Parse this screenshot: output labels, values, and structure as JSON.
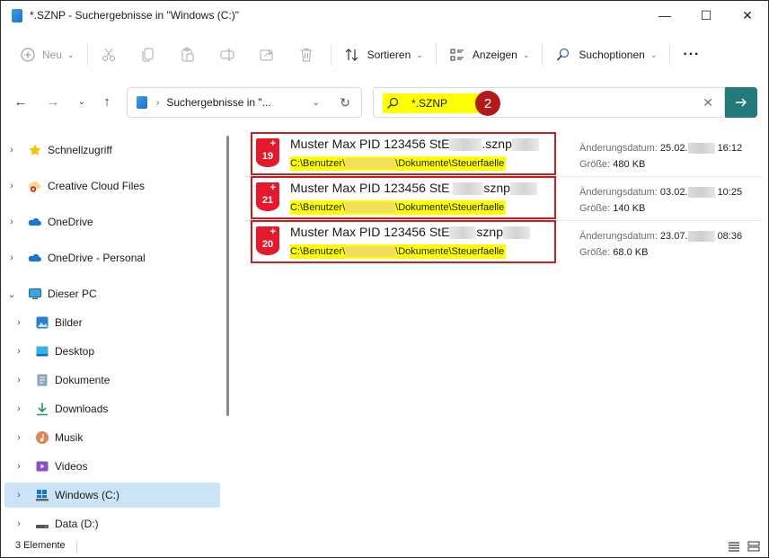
{
  "window": {
    "title": "*.SZNP - Suchergebnisse in \"Windows (C:)\""
  },
  "toolbar": {
    "new_label": "Neu",
    "sort_label": "Sortieren",
    "view_label": "Anzeigen",
    "search_options_label": "Suchoptionen",
    "more_label": "···"
  },
  "address": {
    "path": "Suchergebnisse in \"..."
  },
  "search": {
    "query": "*.SZNP",
    "badge": "2"
  },
  "sidebar": {
    "items": [
      {
        "label": "Schnellzugriff",
        "icon": "star-icon"
      },
      {
        "label": "Creative Cloud Files",
        "icon": "creative-cloud-icon"
      },
      {
        "label": "OneDrive",
        "icon": "cloud-icon"
      },
      {
        "label": "OneDrive - Personal",
        "icon": "cloud-icon"
      },
      {
        "label": "Dieser PC",
        "icon": "monitor-icon"
      },
      {
        "label": "Bilder",
        "icon": "pictures-icon"
      },
      {
        "label": "Desktop",
        "icon": "desktop-icon"
      },
      {
        "label": "Dokumente",
        "icon": "documents-icon"
      },
      {
        "label": "Downloads",
        "icon": "download-icon"
      },
      {
        "label": "Musik",
        "icon": "music-icon"
      },
      {
        "label": "Videos",
        "icon": "videos-icon"
      },
      {
        "label": "Windows (C:)",
        "icon": "drive-c-icon"
      },
      {
        "label": "Data (D:)",
        "icon": "drive-icon"
      }
    ]
  },
  "results": {
    "date_label": "Änderungsdatum:",
    "size_label": "Größe:",
    "path_prefix": "C:\\Benutzer\\",
    "path_suffix": "\\Dokumente\\Steuerfaelle",
    "items": [
      {
        "badge": "19",
        "name_start": "Muster Max PID 123456 StE",
        "name_ext": ".sznp",
        "date_start": "25.02.",
        "time": "16:12",
        "size": "480 KB"
      },
      {
        "badge": "21",
        "name_start": "Muster Max PID 123456 StE",
        "name_ext": "sznp",
        "date_start": "03.02.",
        "time": "10:25",
        "size": "140 KB"
      },
      {
        "badge": "20",
        "name_start": "Muster Max PID 123456 StE",
        "name_ext": "sznp",
        "date_start": "23.07.",
        "time": "08:36",
        "size": "68.0 KB"
      }
    ]
  },
  "status": {
    "count": "3 Elemente"
  },
  "colors": {
    "highlight": "#ffff00",
    "box_border": "#c81e1e",
    "pdf_red": "#e5192b",
    "go_button": "#237a7a",
    "selected": "#cce4f7"
  }
}
